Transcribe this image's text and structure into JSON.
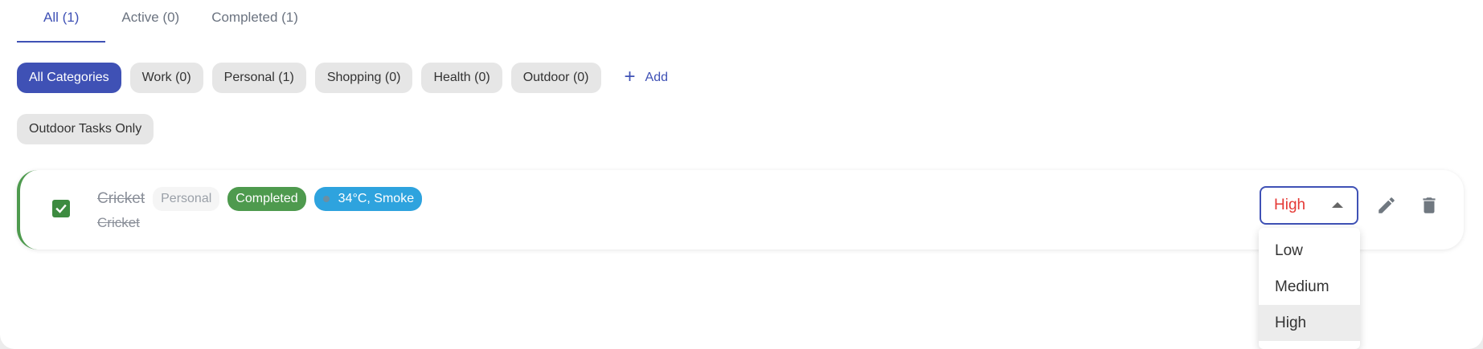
{
  "tabs": [
    {
      "label": "All (1)",
      "active": true
    },
    {
      "label": "Active (0)",
      "active": false
    },
    {
      "label": "Completed (1)",
      "active": false
    }
  ],
  "categories": [
    {
      "label": "All Categories",
      "active": true
    },
    {
      "label": "Work (0)",
      "active": false
    },
    {
      "label": "Personal (1)",
      "active": false
    },
    {
      "label": "Shopping (0)",
      "active": false
    },
    {
      "label": "Health (0)",
      "active": false
    },
    {
      "label": "Outdoor (0)",
      "active": false
    }
  ],
  "add_button": {
    "label": "Add",
    "icon": "plus-icon"
  },
  "outdoor_filter": {
    "label": "Outdoor Tasks Only"
  },
  "task": {
    "title": "Cricket",
    "description": "Cricket",
    "category": "Personal",
    "status": "Completed",
    "weather": "34°C, Smoke",
    "completed": true,
    "priority": "High"
  },
  "priority_options": [
    "Low",
    "Medium",
    "High"
  ],
  "colors": {
    "accent": "#3f51b5",
    "completed_green": "#4e9a4e",
    "weather_blue": "#2ea3de",
    "priority_high": "#e53935"
  }
}
